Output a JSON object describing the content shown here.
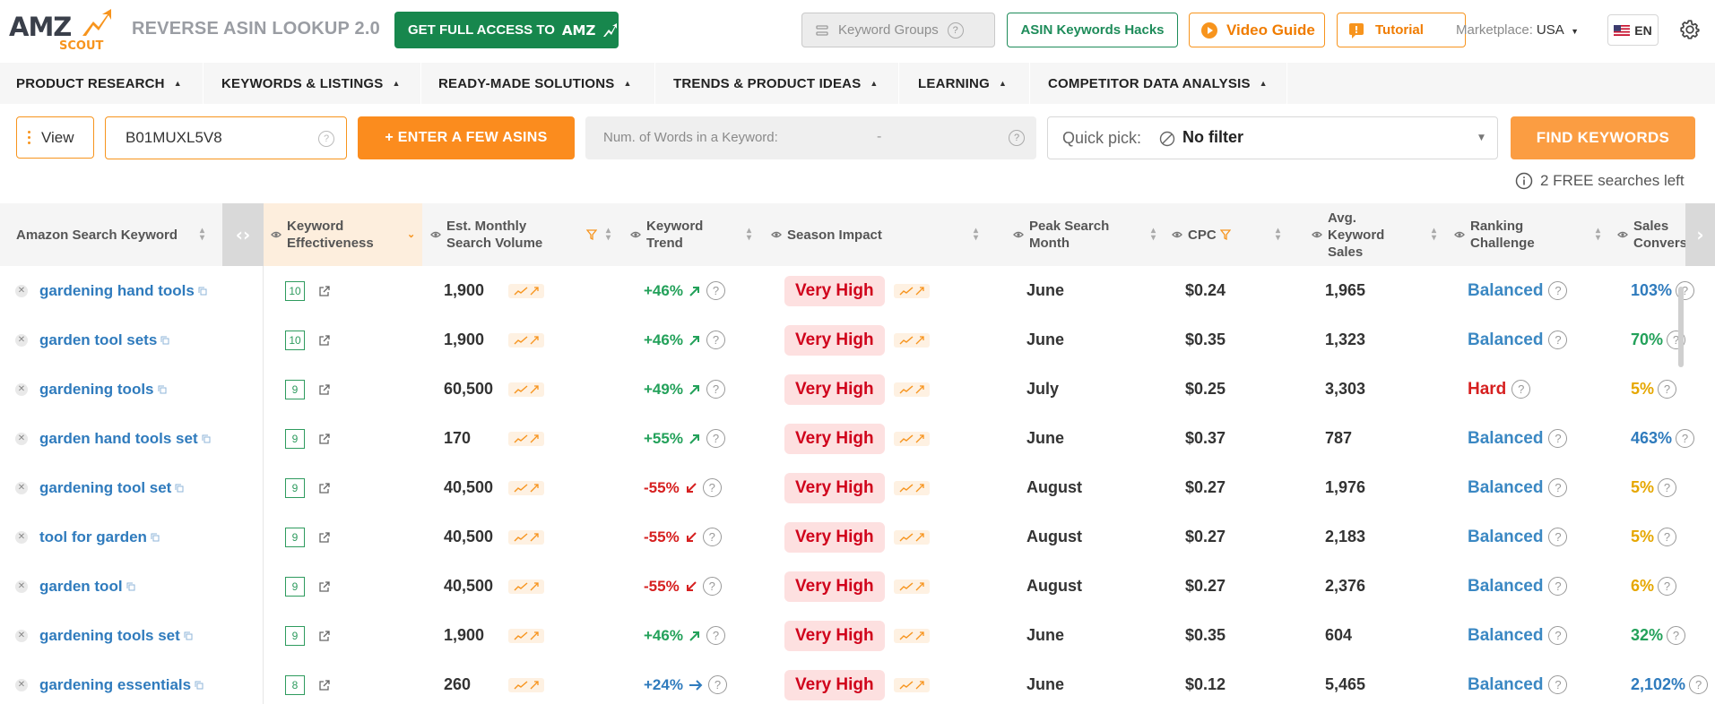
{
  "header": {
    "logo_amz": "AMZ",
    "logo_scout": "SCOUT",
    "app_title": "REVERSE ASIN LOOKUP 2.0",
    "full_access_label": "GET FULL ACCESS TO",
    "full_access_logo": "AMZ",
    "keyword_groups_label": "Keyword Groups",
    "asin_hacks_label": "ASIN Keywords Hacks",
    "video_guide_label": "Video Guide",
    "tutorial_label": "Tutorial",
    "marketplace_label": "Marketplace:",
    "marketplace_value": "USA",
    "language": "EN",
    "accent_color": "#f7941d",
    "brand_green": "#17874d"
  },
  "nav": {
    "items": [
      {
        "label": "PRODUCT RESEARCH"
      },
      {
        "label": "KEYWORDS & LISTINGS"
      },
      {
        "label": "READY-MADE SOLUTIONS"
      },
      {
        "label": "TRENDS & PRODUCT IDEAS"
      },
      {
        "label": "LEARNING"
      },
      {
        "label": "COMPETITOR DATA ANALYSIS"
      }
    ]
  },
  "search": {
    "view_label": "View",
    "asin_value": "B01MUXL5V8",
    "enter_asins_label": "+ ENTER A FEW ASINS",
    "words_label": "Num. of Words in a Keyword:",
    "words_value": "-",
    "quick_pick_label": "Quick pick:",
    "quick_pick_value": "No filter",
    "find_label": "FIND KEYWORDS",
    "free_searches": "2 FREE searches left"
  },
  "table": {
    "columns": {
      "keyword": "Amazon Search Keyword",
      "effectiveness": "Keyword Effectiveness",
      "volume": "Est. Monthly Search Volume",
      "trend": "Keyword Trend",
      "season": "Season Impact",
      "peak": "Peak Search Month",
      "cpc": "CPC",
      "sales": "Avg. Keyword Sales",
      "ranking": "Ranking Challenge",
      "conversion": "Sales Convers"
    },
    "rows": [
      {
        "keyword": "gardening hand tools",
        "effectiveness": "10",
        "volume": "1,900",
        "trend": "+46%",
        "trend_dir": "up",
        "season": "Very High",
        "peak": "June",
        "cpc": "$0.24",
        "sales": "1,965",
        "ranking": "Balanced",
        "ranking_level": "bal",
        "conversion": "103%",
        "conv_color": "blue"
      },
      {
        "keyword": "garden tool sets",
        "effectiveness": "10",
        "volume": "1,900",
        "trend": "+46%",
        "trend_dir": "up",
        "season": "Very High",
        "peak": "June",
        "cpc": "$0.35",
        "sales": "1,323",
        "ranking": "Balanced",
        "ranking_level": "bal",
        "conversion": "70%",
        "conv_color": "green"
      },
      {
        "keyword": "gardening tools",
        "effectiveness": "9",
        "volume": "60,500",
        "trend": "+49%",
        "trend_dir": "up",
        "season": "Very High",
        "peak": "July",
        "cpc": "$0.25",
        "sales": "3,303",
        "ranking": "Hard",
        "ranking_level": "hard",
        "conversion": "5%",
        "conv_color": "yellow"
      },
      {
        "keyword": "garden hand tools set",
        "effectiveness": "9",
        "volume": "170",
        "trend": "+55%",
        "trend_dir": "up",
        "season": "Very High",
        "peak": "June",
        "cpc": "$0.37",
        "sales": "787",
        "ranking": "Balanced",
        "ranking_level": "bal",
        "conversion": "463%",
        "conv_color": "blue"
      },
      {
        "keyword": "gardening tool set",
        "effectiveness": "9",
        "volume": "40,500",
        "trend": "-55%",
        "trend_dir": "down",
        "season": "Very High",
        "peak": "August",
        "cpc": "$0.27",
        "sales": "1,976",
        "ranking": "Balanced",
        "ranking_level": "bal",
        "conversion": "5%",
        "conv_color": "yellow"
      },
      {
        "keyword": "tool for garden",
        "effectiveness": "9",
        "volume": "40,500",
        "trend": "-55%",
        "trend_dir": "down",
        "season": "Very High",
        "peak": "August",
        "cpc": "$0.27",
        "sales": "2,183",
        "ranking": "Balanced",
        "ranking_level": "bal",
        "conversion": "5%",
        "conv_color": "yellow"
      },
      {
        "keyword": "garden tool",
        "effectiveness": "9",
        "volume": "40,500",
        "trend": "-55%",
        "trend_dir": "down",
        "season": "Very High",
        "peak": "August",
        "cpc": "$0.27",
        "sales": "2,376",
        "ranking": "Balanced",
        "ranking_level": "bal",
        "conversion": "6%",
        "conv_color": "yellow"
      },
      {
        "keyword": "gardening tools set",
        "effectiveness": "9",
        "volume": "1,900",
        "trend": "+46%",
        "trend_dir": "up",
        "season": "Very High",
        "peak": "June",
        "cpc": "$0.35",
        "sales": "604",
        "ranking": "Balanced",
        "ranking_level": "bal",
        "conversion": "32%",
        "conv_color": "green"
      },
      {
        "keyword": "gardening essentials",
        "effectiveness": "8",
        "volume": "260",
        "trend": "+24%",
        "trend_dir": "flat",
        "season": "Very High",
        "peak": "June",
        "cpc": "$0.12",
        "sales": "5,465",
        "ranking": "Balanced",
        "ranking_level": "bal",
        "conversion": "2,102%",
        "conv_color": "blue"
      }
    ]
  }
}
